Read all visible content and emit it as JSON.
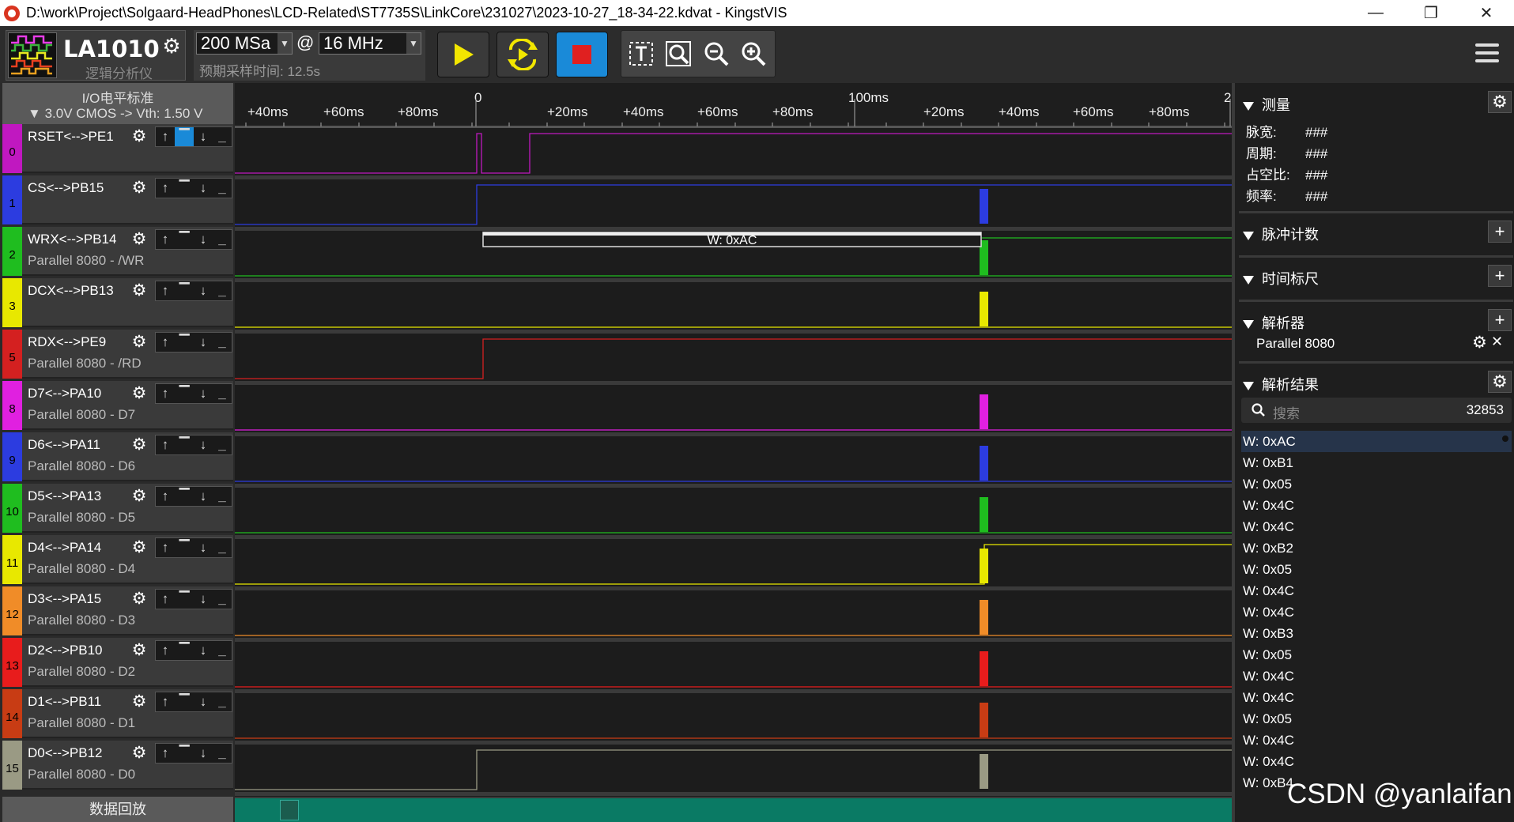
{
  "window": {
    "title": "D:\\work\\Project\\Solgaard-HeadPhones\\LCD-Related\\ST7735S\\LinkCore\\231027\\2023-10-27_18-34-22.kdvat - KingstVIS",
    "minimize": "—",
    "restore": "❐",
    "close": "✕"
  },
  "toolbar": {
    "device_name": "LA1010",
    "device_sub": "逻辑分析仪",
    "sample_rate": "200 MSa",
    "at": "@",
    "sample_depth": "16 MHz",
    "estimate": "预期采样时间: 12.5s"
  },
  "left": {
    "io_title": "I/O电平标准",
    "io_value": "3.0V CMOS -> Vth: 1.50 V",
    "playback": "数据回放"
  },
  "channels": [
    {
      "num": "0",
      "name": "RSET<-->PE1",
      "sub": "",
      "color": "#c018c0"
    },
    {
      "num": "1",
      "name": "CS<-->PB15",
      "sub": "",
      "color": "#2c3ce0"
    },
    {
      "num": "2",
      "name": "WRX<-->PB14",
      "sub": "Parallel 8080 - /WR",
      "color": "#1fbd1f"
    },
    {
      "num": "3",
      "name": "DCX<-->PB13",
      "sub": "",
      "color": "#e8e800"
    },
    {
      "num": "5",
      "name": "RDX<-->PE9",
      "sub": "Parallel 8080 - /RD",
      "color": "#d42020"
    },
    {
      "num": "8",
      "name": "D7<-->PA10",
      "sub": "Parallel 8080 - D7",
      "color": "#e020e0"
    },
    {
      "num": "9",
      "name": "D6<-->PA11",
      "sub": "Parallel 8080 - D6",
      "color": "#2c3ce0"
    },
    {
      "num": "10",
      "name": "D5<-->PA13",
      "sub": "Parallel 8080 - D5",
      "color": "#1fbd1f"
    },
    {
      "num": "11",
      "name": "D4<-->PA14",
      "sub": "Parallel 8080 - D4",
      "color": "#e8e800"
    },
    {
      "num": "12",
      "name": "D3<-->PA15",
      "sub": "Parallel 8080 - D3",
      "color": "#f08c28"
    },
    {
      "num": "13",
      "name": "D2<-->PB10",
      "sub": "Parallel 8080 - D2",
      "color": "#e81c1c"
    },
    {
      "num": "14",
      "name": "D1<-->PB11",
      "sub": "Parallel 8080 - D1",
      "color": "#c83c14"
    },
    {
      "num": "15",
      "name": "D0<-->PB12",
      "sub": "Parallel 8080 - D0",
      "color": "#9a9a84"
    }
  ],
  "trigger_icons": [
    "rising-edge",
    "high-level",
    "falling-edge",
    "low-level"
  ],
  "timeline": {
    "ticks": [
      "+40ms",
      "+60ms",
      "+80ms",
      "0",
      "+20ms",
      "+40ms",
      "+60ms",
      "+80ms",
      "100ms",
      "+20ms",
      "+40ms",
      "+60ms",
      "+80ms",
      "2"
    ],
    "decode_label": "W: 0xAC"
  },
  "right": {
    "measure_title": "测量",
    "measures": [
      {
        "label": "脉宽:",
        "value": "###"
      },
      {
        "label": "周期:",
        "value": "###"
      },
      {
        "label": "占空比:",
        "value": "###"
      },
      {
        "label": "频率:",
        "value": "###"
      }
    ],
    "pulse_count_title": "脉冲计数",
    "time_ruler_title": "时间标尺",
    "analyzer_title": "解析器",
    "analyzer_item": "Parallel 8080",
    "results_title": "解析结果",
    "search_placeholder": "搜索",
    "result_count": "32853",
    "results": [
      "W: 0xAC",
      "W: 0xB1",
      "W: 0x05",
      "W: 0x4C",
      "W: 0x4C",
      "W: 0xB2",
      "W: 0x05",
      "W: 0x4C",
      "W: 0x4C",
      "W: 0xB3",
      "W: 0x05",
      "W: 0x4C",
      "W: 0x4C",
      "W: 0x05",
      "W: 0x4C",
      "W: 0x4C",
      "W: 0xB4"
    ]
  },
  "watermark": "CSDN @yanlaifan",
  "colors": {
    "accent_green": "#0a7a64",
    "play_button": "#f2e600",
    "stop_button": "#e02020"
  }
}
